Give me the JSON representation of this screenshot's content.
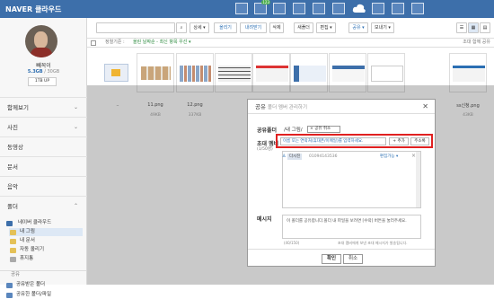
{
  "header": {
    "brand": "NAVER 클라우드",
    "badge_count": "123"
  },
  "user": {
    "name": "빼꼭이",
    "used": "5.3GB",
    "total": "30GB",
    "upgrade": "1TB UP"
  },
  "nav": {
    "items": [
      "함께보기",
      "사진",
      "동영상",
      "문서",
      "음악",
      "폴더"
    ],
    "cloud": "네이버 클라우드",
    "folders": [
      "내 그림",
      "내 문서",
      "자동 올리기",
      "휴지통"
    ],
    "shared_section": "공유",
    "shared": [
      "공유받은 폴더",
      "공유한 폴더/파일"
    ]
  },
  "toolbar": {
    "search_placeholder": "",
    "detail": "상세 ▾",
    "upload": "올리기",
    "download": "내려받기",
    "delete": "삭제",
    "new_folder": "새폴더",
    "edit": "편집 ▾",
    "share": "공유 ▾",
    "send": "보내기 ▾"
  },
  "pathbar": {
    "sort": "정렬기준 :",
    "sort_value": "올린 날짜순 - 최신 항목 우선 ▾",
    "right": "조대 함께 공유"
  },
  "files": [
    {
      "name": "..",
      "size": ""
    },
    {
      "name": "11.png",
      "size": "49KB"
    },
    {
      "name": "12.png",
      "size": "337KB"
    },
    {
      "name": "",
      "size": ""
    },
    {
      "name": "",
      "size": ""
    },
    {
      "name": "",
      "size": ""
    },
    {
      "name": "",
      "size": ""
    },
    {
      "name": "",
      "size": ""
    },
    {
      "name": "ss신청.png",
      "size": "43KB"
    }
  ],
  "modal": {
    "title": "공유",
    "subtitle": "폴더 멤버 관리하기",
    "close": "✕",
    "folder_label": "공유폴더",
    "folder_value": "/내 그림/",
    "folder_tag": "× 공유 취소",
    "invite_label": "초대 멤버",
    "invite_count": "(1/50명)",
    "invite_placeholder": "이름 또는 연락처(휴대폰/이메일)를 입력하세요.",
    "add": "+ 추가",
    "address": "주소록",
    "member_name": "다시진",
    "member_phone": "01094143536",
    "member_perm": "편집가능 ▾",
    "message_label": "메시지",
    "message": "이 폴더를 공유합니다.폴더 내 파일을 보려면 [수락] 버튼을 눌러주세요.",
    "message_count": "(40/150)",
    "notice": "초대 멤버에게 보낸 초대 메시지가 발송됩니다.",
    "ok": "확인",
    "cancel": "취소"
  }
}
